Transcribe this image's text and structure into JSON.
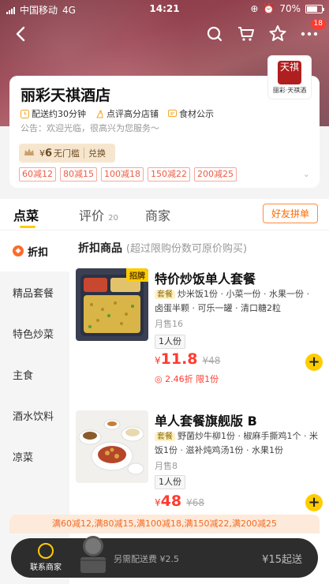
{
  "status": {
    "carrier": "中国移动",
    "network": "4G",
    "time": "14:21",
    "battery": "70%",
    "battery_level": 0.7
  },
  "nav": {
    "notify_count": "18"
  },
  "store": {
    "name": "丽彩天祺酒店",
    "logo_seal_text": "天祺",
    "logo_caption": "丽彩·天祺酒",
    "tags": [
      "配送约30分钟",
      "点评高分店铺",
      "食材公示"
    ],
    "notice": "公告：欢迎光临，很高兴为您服务～",
    "vip": {
      "currency": "¥",
      "amount": "6",
      "label": "无门槛",
      "action": "兑换"
    },
    "coupons": [
      "60减12",
      "80减15",
      "100减18",
      "150减22",
      "200减25"
    ]
  },
  "tabs": {
    "order": "点菜",
    "reviews": "评价",
    "reviews_count": "20",
    "merchant": "商家",
    "friend_button": "好友拼单"
  },
  "sidebar": [
    "折扣",
    "精品套餐",
    "特色炒菜",
    "主食",
    "酒水饮料",
    "凉菜"
  ],
  "section": {
    "title": "折扣商品",
    "subtitle": "(超过限购份数可原价购买)"
  },
  "items": [
    {
      "badge": "招牌",
      "title": "特价炒饭单人套餐",
      "tag": "套餐",
      "desc": "炒米饭1份 · 小菜一份 · 水果一份 · 卤蛋半颗 · 可乐一罐 · 清口糖2粒",
      "sales": "月售16",
      "portion": "1人份",
      "currency": "¥",
      "price": "11.8",
      "orig_price": "¥48",
      "promo": "2.46折 限1份"
    },
    {
      "title": "单人套餐旗舰版 B",
      "tag": "套餐",
      "desc": "野菌炒牛柳1份 · 椒麻手撕鸡1个 · 米饭1份 · 滋补炖鸡汤1份 · 水果1份",
      "sales": "月售8",
      "portion": "1人份",
      "currency": "¥",
      "price": "48",
      "orig_price": "¥68"
    }
  ],
  "promo_bar": "满60减12,满80减15,满100减18,满150减22,满200减25",
  "cart": {
    "contact": "联系商家",
    "fee": "另需配送费 ¥2.5",
    "minimum": "¥15起送"
  },
  "colors": {
    "accent": "#ffcc00",
    "price": "#ff3b30",
    "banner": "#9a4552"
  }
}
